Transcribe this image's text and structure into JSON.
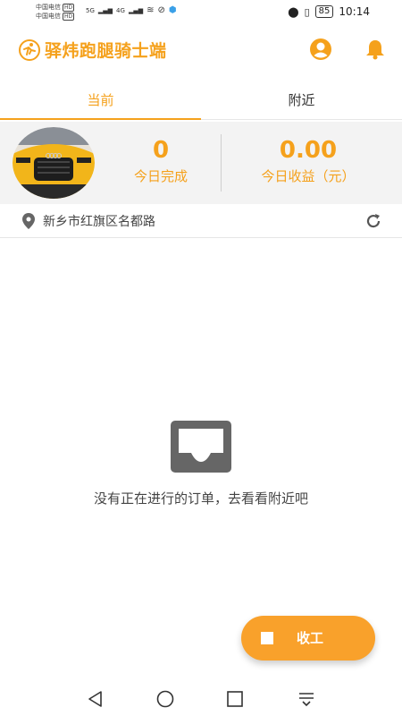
{
  "status_bar": {
    "carrier_1": "中国电信",
    "carrier_2": "中国电信",
    "hd_badge": "HD",
    "net_1": "5G",
    "net_2": "4G",
    "battery": "85",
    "time": "10:14"
  },
  "header": {
    "title": "驿炜跑腿骑士端",
    "user_icon": "user-circle-icon",
    "bell_icon": "bell-icon"
  },
  "tabs": [
    {
      "label": "当前",
      "active": true
    },
    {
      "label": "附近",
      "active": false
    }
  ],
  "stats": {
    "completed_value": "0",
    "completed_label": "今日完成",
    "earnings_value": "0.00",
    "earnings_label": "今日收益（元）"
  },
  "location": {
    "address": "新乡市红旗区名都路",
    "pin_icon": "location-pin-icon",
    "refresh_icon": "refresh-icon"
  },
  "empty_state": {
    "icon": "inbox-icon",
    "message": "没有正在进行的订单，去看看附近吧"
  },
  "fab": {
    "label": "收工",
    "icon": "stop-icon"
  },
  "colors": {
    "accent": "#f5a11c",
    "fab": "#f9a12b",
    "panel_bg": "#f3f3f3"
  }
}
